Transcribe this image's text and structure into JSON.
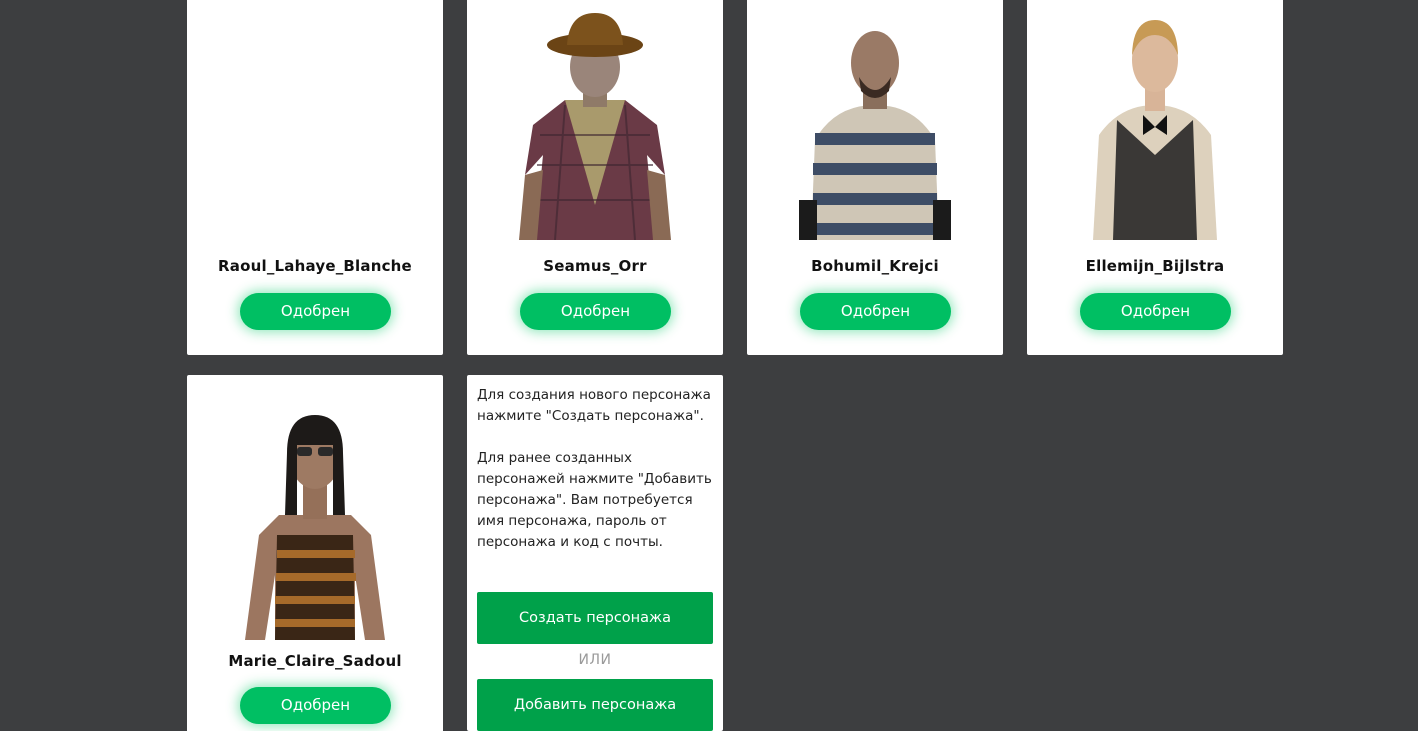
{
  "characters": [
    {
      "name": "Raoul_Lahaye_Blanche",
      "status": "Одобрен",
      "avatar": "none"
    },
    {
      "name": "Seamus_Orr",
      "status": "Одобрен",
      "avatar": "cowboy-hat-plaid-shirt"
    },
    {
      "name": "Bohumil_Krejci",
      "status": "Одобрен",
      "avatar": "striped-shirt"
    },
    {
      "name": "Ellemijn_Bijlstra",
      "status": "Одобрен",
      "avatar": "vest-bowtie"
    },
    {
      "name": "Marie_Claire_Sadoul",
      "status": "Одобрен",
      "avatar": "sunglasses-striped-top"
    }
  ],
  "info": {
    "paragraph1": "Для создания нового персонажа нажмите \"Создать персонажа\".",
    "paragraph2": "Для ранее созданных персонажей нажмите \"Добавить персонажа\". Вам потребуется имя персонажа, пароль от персонажа и код с почты.",
    "create_label": "Создать персонажа",
    "or_label": "ИЛИ",
    "add_label": "Добавить персонажа"
  },
  "colors": {
    "background": "#3d3e40",
    "card": "#ffffff",
    "approved_button": "#00bf63",
    "action_button": "#00a14a"
  }
}
